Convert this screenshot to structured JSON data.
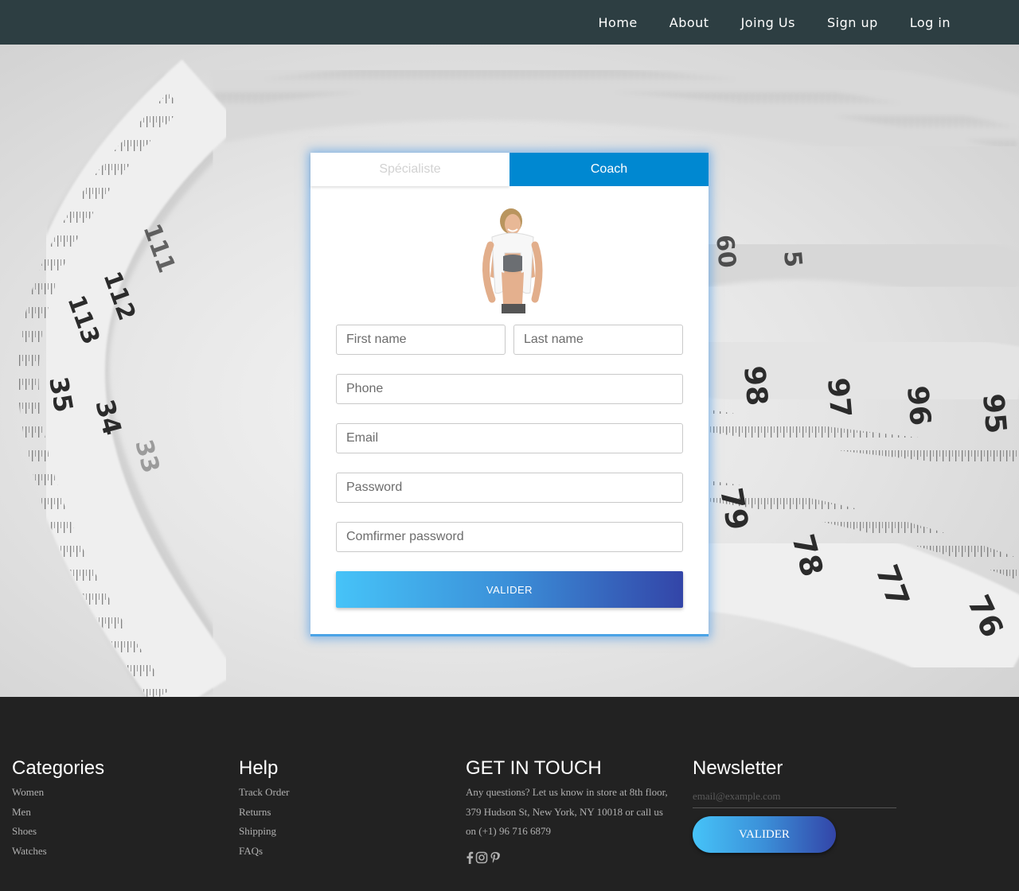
{
  "nav": {
    "items": [
      {
        "label": "Home"
      },
      {
        "label": "About"
      },
      {
        "label": "Joing Us"
      },
      {
        "label": "Sign up"
      },
      {
        "label": "Log in"
      }
    ]
  },
  "hero": {
    "tape_numbers": [
      "111",
      "112",
      "113",
      "35",
      "34",
      "33",
      "60",
      "5",
      "98",
      "97",
      "96",
      "95",
      "79",
      "78",
      "77",
      "76"
    ]
  },
  "form": {
    "tabs": [
      {
        "label": "Spécialiste",
        "active": false
      },
      {
        "label": "Coach",
        "active": true
      }
    ],
    "fields": {
      "first_name": {
        "placeholder": "First name",
        "value": ""
      },
      "last_name": {
        "placeholder": "Last name",
        "value": ""
      },
      "phone": {
        "placeholder": "Phone",
        "value": ""
      },
      "email": {
        "placeholder": "Email",
        "value": ""
      },
      "password": {
        "placeholder": "Password",
        "value": ""
      },
      "confirm_password": {
        "placeholder": "Comfirmer password",
        "value": ""
      }
    },
    "submit_label": "VALIDER",
    "accent_color": "#0088d1"
  },
  "footer": {
    "categories": {
      "title": "Categories",
      "links": [
        "Women",
        "Men",
        "Shoes",
        "Watches"
      ]
    },
    "help": {
      "title": "Help",
      "links": [
        "Track Order",
        "Returns",
        "Shipping",
        "FAQs"
      ]
    },
    "contact": {
      "title": "GET IN TOUCH",
      "text": "Any questions? Let us know in store at 8th floor, 379 Hudson St, New York, NY 10018 or call us on (+1) 96 716 6879",
      "social": [
        "facebook-icon",
        "instagram-icon",
        "pinterest-icon"
      ]
    },
    "newsletter": {
      "title": "Newsletter",
      "placeholder": "email@example.com",
      "button_label": "VALIDER"
    }
  }
}
